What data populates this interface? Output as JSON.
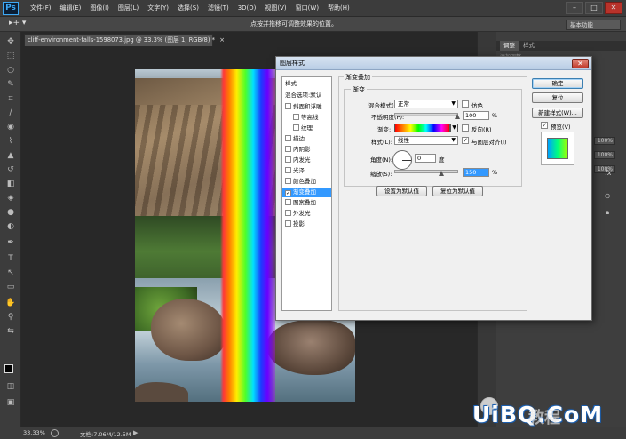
{
  "app": {
    "logo": "Ps"
  },
  "menu": [
    "文件(F)",
    "编辑(E)",
    "图像(I)",
    "图层(L)",
    "文字(Y)",
    "选择(S)",
    "滤镜(T)",
    "3D(D)",
    "视图(V)",
    "窗口(W)",
    "帮助(H)"
  ],
  "window_controls": [
    "–",
    "□",
    "✕"
  ],
  "options_bar": {
    "hint": "点按并拖移可调整效果的位置。",
    "workspace": "基本功能"
  },
  "document": {
    "tab_title": "cliff-environment-falls-1598073.jpg @ 33.3% (图层 1, RGB/8) *",
    "close": "×"
  },
  "right_panel": {
    "tabs": [
      "调整",
      "样式"
    ],
    "subtitle": "添加调整",
    "fields": [
      "100%",
      "100%",
      "100%"
    ],
    "fx_label": "fx"
  },
  "status_bar": {
    "zoom": "33.33%",
    "doc_size": "文档:7.06M/12.5M",
    "arrow": "▶"
  },
  "dialog": {
    "title": "图层样式",
    "close": "✕",
    "styles_header": "样式",
    "styles_blend": "混合选项:默认",
    "styles": [
      {
        "label": "斜面和浮雕",
        "checked": false,
        "indent": false
      },
      {
        "label": "等高线",
        "checked": false,
        "indent": true
      },
      {
        "label": "纹理",
        "checked": false,
        "indent": true
      },
      {
        "label": "描边",
        "checked": false,
        "indent": false
      },
      {
        "label": "内阴影",
        "checked": false,
        "indent": false
      },
      {
        "label": "内发光",
        "checked": false,
        "indent": false
      },
      {
        "label": "光泽",
        "checked": false,
        "indent": false
      },
      {
        "label": "颜色叠加",
        "checked": false,
        "indent": false
      },
      {
        "label": "渐变叠加",
        "checked": true,
        "indent": false,
        "selected": true
      },
      {
        "label": "图案叠加",
        "checked": false,
        "indent": false
      },
      {
        "label": "外发光",
        "checked": false,
        "indent": false
      },
      {
        "label": "投影",
        "checked": false,
        "indent": false
      }
    ],
    "section_title": "渐变叠加",
    "group_title": "渐变",
    "blend_mode_label": "混合模式(O):",
    "blend_mode_value": "正常",
    "dither_label": "仿色",
    "opacity_label": "不透明度(P):",
    "opacity_value": "100",
    "opacity_unit": "%",
    "opacity_fraction": 1.0,
    "gradient_label": "渐变:",
    "reverse_label": "反向(R)",
    "style_label": "样式(L):",
    "style_value": "线性",
    "align_label": "与图层对齐(I)",
    "angle_label": "角度(N):",
    "angle_value": "0",
    "angle_unit": "度",
    "scale_label": "缩放(S):",
    "scale_value": "150",
    "scale_unit": "%",
    "scale_fraction": 0.75,
    "set_default": "设置为默认值",
    "reset_default": "复位为默认值",
    "ok": "确定",
    "cancel": "复位",
    "new_style": "新建样式(W)...",
    "preview_label": "预览(V)"
  },
  "watermark": {
    "main": "UiBQ.CoM",
    "cn": "教程"
  }
}
